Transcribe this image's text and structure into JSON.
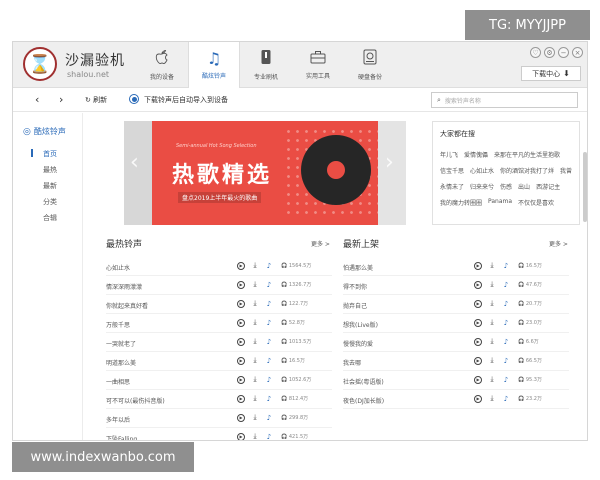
{
  "watermarks": {
    "top": "TG: MYYJJPP",
    "bottom": "www.indexwanbo.com"
  },
  "app": {
    "brand": "沙漏验机",
    "brand_sub": "shalou.net",
    "logo_glyph": "⌛"
  },
  "nav": [
    {
      "label": "我的设备",
      "icon": ""
    },
    {
      "label": "酷炫铃声",
      "icon": "♫"
    },
    {
      "label": "专业刷机",
      "icon": "⚙"
    },
    {
      "label": "实用工具",
      "icon": "⌂"
    },
    {
      "label": "硬盘备份",
      "icon": "⌹"
    }
  ],
  "window_buttons": [
    "♡",
    "⚙",
    "−",
    "×"
  ],
  "download_center": "下载中心",
  "toolbar": {
    "back": "‹",
    "forward": "›",
    "refresh": "刷新",
    "auto_import": "下载铃声后自动导入到设备",
    "search_placeholder": "搜索铃声名称"
  },
  "sidebar": {
    "heading": "酷炫铃声",
    "items": [
      "首页",
      "最热",
      "最新",
      "分类",
      "合辑"
    ]
  },
  "banner": {
    "en": "Semi-annual Hot Song Selection",
    "title": "热歌精选",
    "sub": "盘点2019上半年最火的歌曲"
  },
  "hot_panel": {
    "title": "大家都在搜",
    "tags": [
      "年儿飞",
      "爱情傀儡",
      "来那在平凡的生活里抱歌",
      "信宝千思",
      "心如止水",
      "你的酒馆对我打了烊",
      "我曾",
      "永情未了",
      "归来来兮",
      "伤感",
      "出山",
      "西游记主",
      "我的魔力转圈圈",
      "Panama",
      "不仅仅是喜欢"
    ]
  },
  "hot_list": {
    "title": "最热铃声",
    "more": "更多 >",
    "rows": [
      {
        "name": "心如止水",
        "count": "1564.5万"
      },
      {
        "name": "情深深雨濛濛",
        "count": "1326.7万"
      },
      {
        "name": "你就起来真好看",
        "count": "122.7万"
      },
      {
        "name": "万般千思",
        "count": "52.8万"
      },
      {
        "name": "一哭就老了",
        "count": "1013.5万"
      },
      {
        "name": "明道那么美",
        "count": "16.5万"
      },
      {
        "name": "一曲相思",
        "count": "1052.6万"
      },
      {
        "name": "可不可以(最伤抖音版)",
        "count": "812.4万"
      },
      {
        "name": "多年以后",
        "count": "299.8万"
      },
      {
        "name": "下坠Falling",
        "count": "421.5万"
      }
    ]
  },
  "new_list": {
    "title": "最新上架",
    "more": "更多 >",
    "rows": [
      {
        "name": "怕遇那么美",
        "count": "16.5万"
      },
      {
        "name": "得不到你",
        "count": "47.6万"
      },
      {
        "name": "抛弃自己",
        "count": "20.7万"
      },
      {
        "name": "想我(Live版)",
        "count": "23.0万"
      },
      {
        "name": "慢慢我的爱",
        "count": "6.6万"
      },
      {
        "name": "我去哪",
        "count": "66.5万"
      },
      {
        "name": "社会摇(粤语版)",
        "count": "95.3万"
      },
      {
        "name": "夜色(DJ加长版)",
        "count": "23.2万"
      }
    ]
  },
  "actions": {
    "play": "▶",
    "download": "⤓",
    "ring": "♪",
    "plays": "🎧"
  }
}
